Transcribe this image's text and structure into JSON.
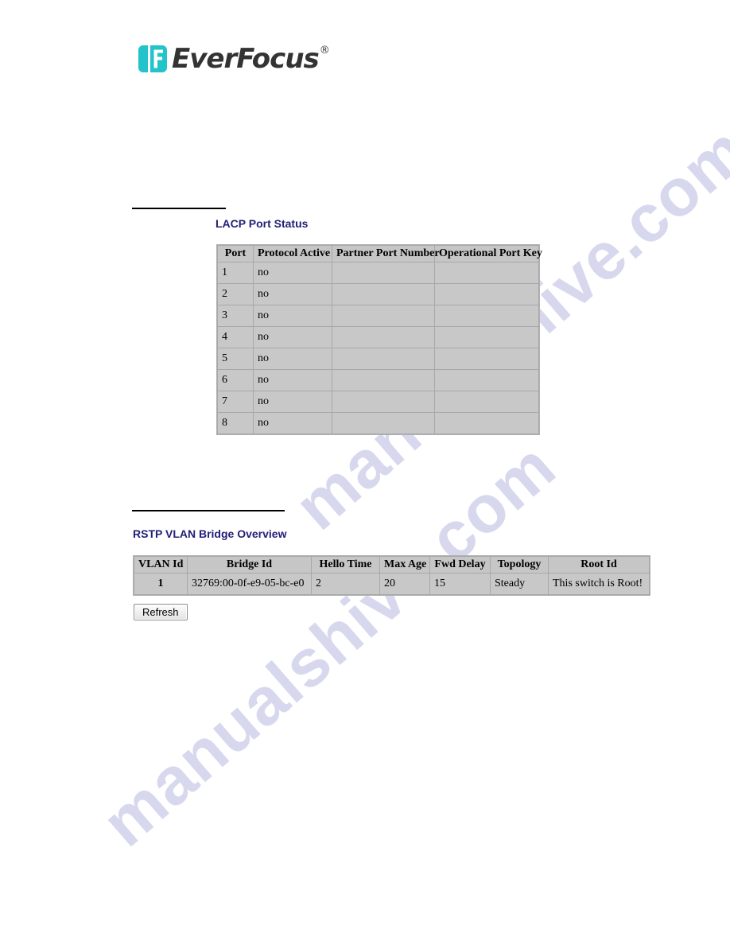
{
  "brand": {
    "name": "EverFocus",
    "registered_mark": "®",
    "logo_color": "#22c3c9",
    "wordmark_color": "#333333"
  },
  "watermark": {
    "text": "manualshive.com",
    "color": "#b7b9e0"
  },
  "sections": [
    {
      "id": "lacp",
      "title": "LACP Port Status",
      "title_color": "#232078",
      "table": {
        "columns": [
          "Port",
          "Protocol Active",
          "Partner Port Number",
          "Operational Port Key"
        ],
        "rows": [
          {
            "port": "1",
            "protocol_active": "no",
            "partner_port_number": "",
            "operational_port_key": ""
          },
          {
            "port": "2",
            "protocol_active": "no",
            "partner_port_number": "",
            "operational_port_key": ""
          },
          {
            "port": "3",
            "protocol_active": "no",
            "partner_port_number": "",
            "operational_port_key": ""
          },
          {
            "port": "4",
            "protocol_active": "no",
            "partner_port_number": "",
            "operational_port_key": ""
          },
          {
            "port": "5",
            "protocol_active": "no",
            "partner_port_number": "",
            "operational_port_key": ""
          },
          {
            "port": "6",
            "protocol_active": "no",
            "partner_port_number": "",
            "operational_port_key": ""
          },
          {
            "port": "7",
            "protocol_active": "no",
            "partner_port_number": "",
            "operational_port_key": ""
          },
          {
            "port": "8",
            "protocol_active": "no",
            "partner_port_number": "",
            "operational_port_key": ""
          }
        ]
      }
    },
    {
      "id": "rstp",
      "title": "RSTP VLAN Bridge Overview",
      "title_color": "#232078",
      "table": {
        "columns": [
          "VLAN Id",
          "Bridge Id",
          "Hello Time",
          "Max Age",
          "Fwd Delay",
          "Topology",
          "Root Id"
        ],
        "rows": [
          {
            "vlan_id": "1",
            "bridge_id": "32769:00-0f-e9-05-bc-e0",
            "hello_time": "2",
            "max_age": "20",
            "fwd_delay": "15",
            "topology": "Steady",
            "root_id": "This switch is Root!"
          }
        ]
      },
      "refresh_label": "Refresh"
    }
  ]
}
